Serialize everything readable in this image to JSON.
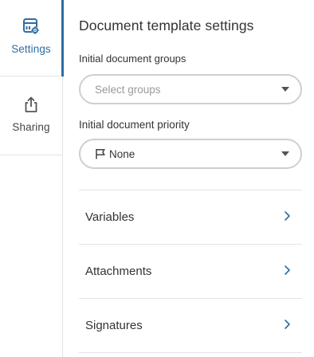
{
  "colors": {
    "accent": "#2e6da4",
    "border": "#cfcfcf",
    "divider": "#e3e3e3",
    "text": "#333333",
    "placeholder": "#9a9a9a"
  },
  "sidebar": {
    "items": [
      {
        "label": "Settings",
        "icon": "settings-doc-gear-icon",
        "active": true
      },
      {
        "label": "Sharing",
        "icon": "share-upload-icon",
        "active": false
      }
    ]
  },
  "main": {
    "title": "Document template settings",
    "groups": {
      "label": "Initial document groups",
      "placeholder": "Select groups"
    },
    "priority": {
      "label": "Initial document priority",
      "value": "None",
      "icon": "flag-icon"
    },
    "sections": [
      {
        "label": "Variables"
      },
      {
        "label": "Attachments"
      },
      {
        "label": "Signatures"
      }
    ]
  }
}
